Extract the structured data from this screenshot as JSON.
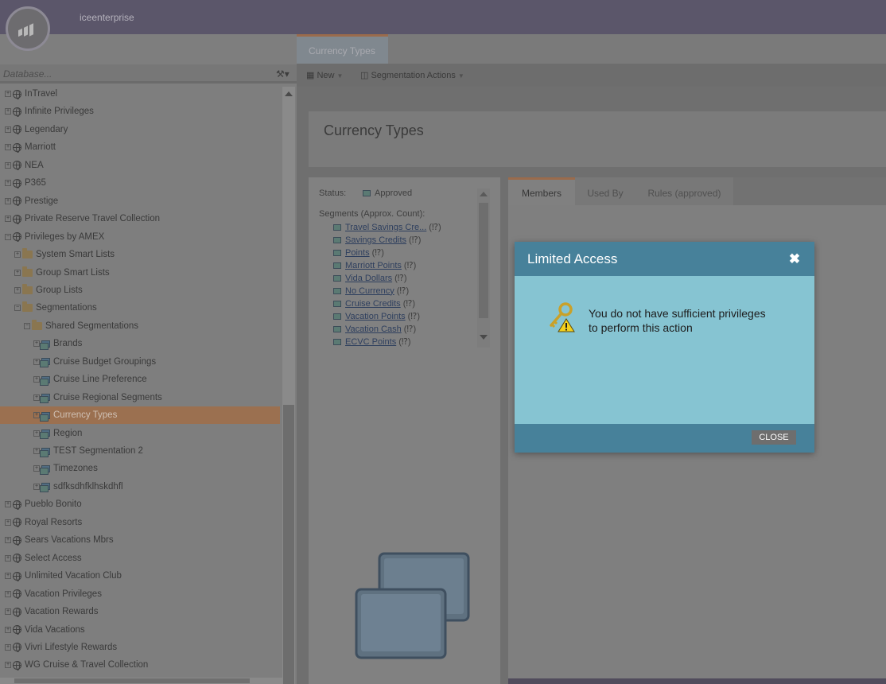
{
  "header": {
    "org_name": "iceenterprise"
  },
  "search": {
    "placeholder": "Database..."
  },
  "tree": {
    "items": [
      {
        "label": "InTravel",
        "icon": "globe-icon",
        "level": 0
      },
      {
        "label": "Infinite Privileges",
        "icon": "globe-icon",
        "level": 0
      },
      {
        "label": "Legendary",
        "icon": "globe-icon",
        "level": 0
      },
      {
        "label": "Marriott",
        "icon": "globe-icon",
        "level": 0
      },
      {
        "label": "NEA",
        "icon": "globe-icon",
        "level": 0
      },
      {
        "label": "P365",
        "icon": "globe-icon",
        "level": 0
      },
      {
        "label": "Prestige",
        "icon": "globe-icon",
        "level": 0
      },
      {
        "label": "Private Reserve Travel Collection",
        "icon": "globe-icon",
        "level": 0
      },
      {
        "label": "Privileges by AMEX",
        "icon": "globe-icon",
        "level": 0,
        "expanded": true
      },
      {
        "label": "System Smart Lists",
        "icon": "folder-icon",
        "level": 1
      },
      {
        "label": "Group Smart Lists",
        "icon": "folder-icon",
        "level": 1
      },
      {
        "label": "Group Lists",
        "icon": "folder-icon",
        "level": 1
      },
      {
        "label": "Segmentations",
        "icon": "folder-icon",
        "level": 1,
        "expanded": true
      },
      {
        "label": "Shared Segmentations",
        "icon": "folder-icon",
        "level": 2,
        "expanded": true
      },
      {
        "label": "Brands",
        "icon": "segmentation-icon",
        "level": 3
      },
      {
        "label": "Cruise Budget Groupings",
        "icon": "segmentation-icon",
        "level": 3
      },
      {
        "label": "Cruise Line Preference",
        "icon": "segmentation-icon",
        "level": 3
      },
      {
        "label": "Cruise Regional Segments",
        "icon": "segmentation-icon",
        "level": 3
      },
      {
        "label": "Currency Types",
        "icon": "segmentation-icon",
        "level": 3,
        "selected": true
      },
      {
        "label": "Region",
        "icon": "segmentation-icon",
        "level": 3
      },
      {
        "label": "TEST Segmentation 2",
        "icon": "segmentation-icon",
        "level": 3
      },
      {
        "label": "Timezones",
        "icon": "segmentation-icon",
        "level": 3
      },
      {
        "label": "sdfksdhfklhskdhfl",
        "icon": "segmentation-icon",
        "level": 3
      },
      {
        "label": "Pueblo Bonito",
        "icon": "globe-icon",
        "level": 0
      },
      {
        "label": "Royal Resorts",
        "icon": "globe-icon",
        "level": 0
      },
      {
        "label": "Sears Vacations Mbrs",
        "icon": "globe-icon",
        "level": 0
      },
      {
        "label": "Select Access",
        "icon": "globe-icon",
        "level": 0
      },
      {
        "label": "Unlimited Vacation Club",
        "icon": "globe-icon",
        "level": 0
      },
      {
        "label": "Vacation Privileges",
        "icon": "globe-icon",
        "level": 0
      },
      {
        "label": "Vacation Rewards",
        "icon": "globe-icon",
        "level": 0
      },
      {
        "label": "Vida Vacations",
        "icon": "globe-icon",
        "level": 0
      },
      {
        "label": "Vivri Lifestyle Rewards",
        "icon": "globe-icon",
        "level": 0
      },
      {
        "label": "WG Cruise & Travel Collection",
        "icon": "globe-icon",
        "level": 0
      }
    ]
  },
  "main": {
    "tab_label": "Currency Types",
    "toolbar": {
      "new_label": "New",
      "actions_label": "Segmentation Actions"
    },
    "page_title": "Currency Types",
    "detail": {
      "status_label": "Status:",
      "status_value": "Approved",
      "segments_label": "Segments (Approx. Count):",
      "segments": [
        {
          "name": "Travel Savings Cre...",
          "count": "(⁉)"
        },
        {
          "name": "Savings Credits",
          "count": "(⁉)"
        },
        {
          "name": "Points",
          "count": "(⁉)"
        },
        {
          "name": "Marriott Points",
          "count": "(⁉)"
        },
        {
          "name": "Vida Dollars",
          "count": "(⁉)"
        },
        {
          "name": "No Currency",
          "count": "(⁉)"
        },
        {
          "name": "Cruise Credits",
          "count": "(⁉)"
        },
        {
          "name": "Vacation Points",
          "count": "(⁉)"
        },
        {
          "name": "Vacation Cash",
          "count": "(⁉)"
        },
        {
          "name": "ECVC Points",
          "count": "(⁉)"
        }
      ]
    },
    "tabs": [
      {
        "label": "Members",
        "active": true
      },
      {
        "label": "Used By",
        "active": false
      },
      {
        "label": "Rules (approved)",
        "active": false
      }
    ]
  },
  "modal": {
    "title": "Limited Access",
    "message_line1": "You do not have sufficient privileges",
    "message_line2": "to perform this action",
    "close_label": "CLOSE"
  },
  "colors": {
    "header_bg": "#5b566a",
    "modal_header": "#47819a",
    "modal_body": "#86c4d2",
    "selected_row": "#9b7050",
    "accent_tab": "#9a6b4c"
  }
}
